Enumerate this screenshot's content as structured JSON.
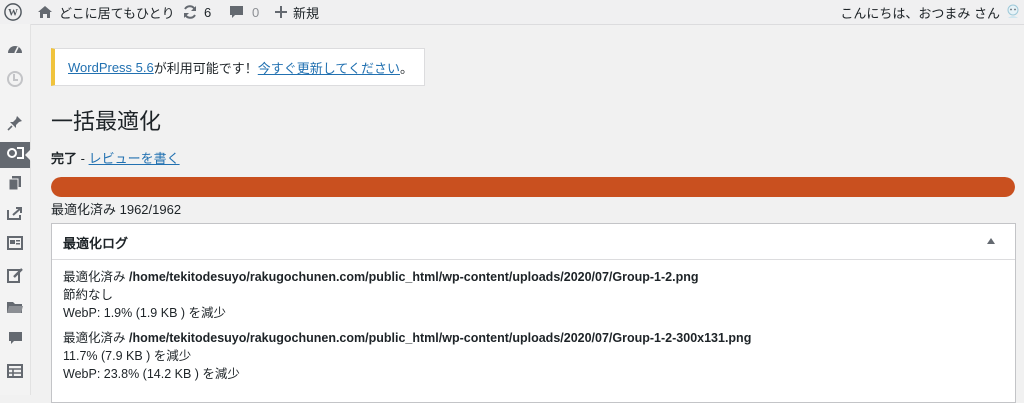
{
  "adminbar": {
    "site_name": "どこに居てもひとり",
    "updates_count": "6",
    "comments_count": "0",
    "new_label": "新規",
    "greeting": "こんにちは、おつまみ さん"
  },
  "notice": {
    "link_version": "WordPress 5.6",
    "middle_text": " が利用可能です！",
    "link_update": "今すぐ更新してください",
    "end_text": "。"
  },
  "page": {
    "title": "一括最適化",
    "status_label": "完了",
    "status_sep": " - ",
    "review_link": "レビューを書く",
    "progress_text": "最適化済み 1962/1962",
    "progress_fraction": 1.0
  },
  "log": {
    "title": "最適化ログ",
    "entries": [
      {
        "prefix": "最適化済み ",
        "path": "/home/tekitodesuyo/rakugochunen.com/public_html/wp-content/uploads/2020/07/Group-1-2.png",
        "line2": "節約なし",
        "line3": "WebP: 1.9% (1.9 KB ) を減少"
      },
      {
        "prefix": "最適化済み ",
        "path": "/home/tekitodesuyo/rakugochunen.com/public_html/wp-content/uploads/2020/07/Group-1-2-300x131.png",
        "line2": "11.7% (7.9 KB ) を減少",
        "line3": "WebP: 23.8% (14.2 KB ) を減少"
      }
    ]
  },
  "colors": {
    "progress": "#c9501f",
    "link": "#2271b1",
    "notice_border": "#f0c33c"
  },
  "icons": {
    "adminbar": [
      "wordpress-icon",
      "home-icon",
      "updates-icon",
      "comment-icon",
      "plus-icon",
      "avatar"
    ],
    "sidebar": [
      "dashboard-icon",
      "jetpack-icon",
      "pin-icon",
      "media-icon",
      "pages-icon",
      "share-icon",
      "posts-grid-icon",
      "feedback-icon",
      "folder-icon",
      "comments-icon",
      "table-icon"
    ]
  }
}
